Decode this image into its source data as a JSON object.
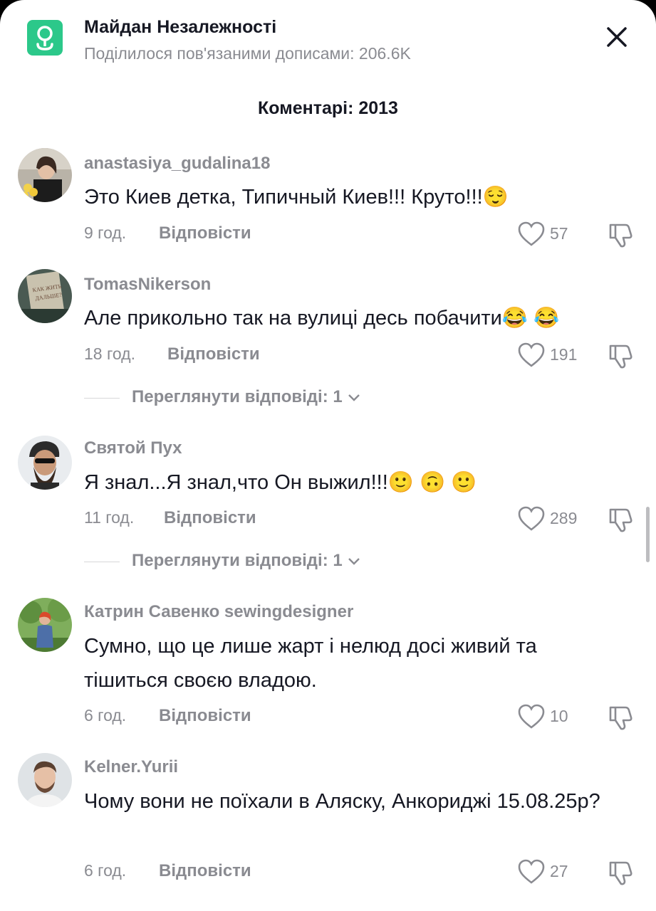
{
  "header": {
    "title": "Майдан Незалежності",
    "subtitle": "Поділилося пов'язаними дописами: 206.6K",
    "icon": "location-pin-icon",
    "accent": "#2cc88a"
  },
  "comments_count": "Коментарі: 2013",
  "reply_label": "Відповісти",
  "comments": [
    {
      "username": "anastasiya_gudalina18",
      "text": "Это Киев детка, Типичный Киев!!! Круто!!!😌",
      "time": "9 год.",
      "likes": "57",
      "replies": null
    },
    {
      "username": "TomasNikerson",
      "text": "Але прикольно так на вулиці десь побачити😂 😂",
      "time": "18 год.",
      "likes": "191",
      "replies": "Переглянути відповіді: 1"
    },
    {
      "username": "Святой Пух",
      "text": "Я знал...Я знал,что Он выжил!!!🙂 🙃 🙂",
      "time": "11 год.",
      "likes": "289",
      "replies": "Переглянути відповіді: 1"
    },
    {
      "username": "Катрин Савенко sewingdesigner",
      "text": "Сумно, що це лише жарт і нелюд досі живий та тішиться своєю владою.",
      "time": "6 год.",
      "likes": "10",
      "replies": null
    },
    {
      "username": "Kelner.Yurii",
      "text": "Чому вони не поїхали в Аляску, Анкориджі 15.08.25р?",
      "time": "6 год.",
      "likes": "27",
      "replies": null
    }
  ]
}
